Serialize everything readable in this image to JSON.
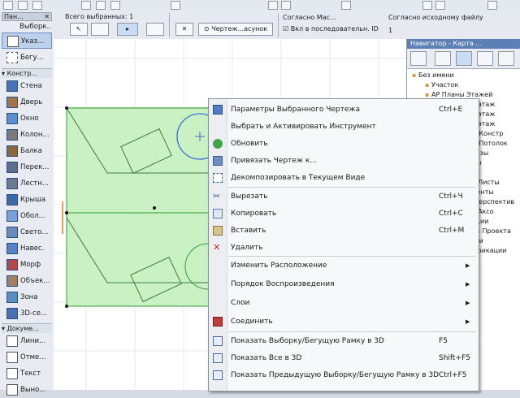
{
  "toolbox": {
    "header": "Пан...",
    "select_label": "Выборк...",
    "arrow_tool": "Указ...",
    "marquee_tool": "Бегу...",
    "section_design": "Констр...",
    "design_tools": [
      "Стена",
      "Дверь",
      "Окно",
      "Колон...",
      "Балка",
      "Перек...",
      "Лестн...",
      "Крыша",
      "Обол...",
      "Свето...",
      "Навес.",
      "Морф",
      "Объек...",
      "Зона",
      "3D-се..."
    ],
    "section_document": "Докуме...",
    "document_tools": [
      "Лини...",
      "Отме...",
      "Текст",
      "Выно..."
    ]
  },
  "infobox": {
    "selection_label": "Всего выбранных: 1",
    "drawing_button": "Чертеж...асунок",
    "scale_label": "Согласно Мас...",
    "sequence_check": "Вкл в последовательн. ID",
    "original_size_label": "Согласно исходному файлу",
    "original_value": "1"
  },
  "navigator": {
    "title": "Навигатор - Карта ...",
    "tree": [
      "Без имени",
      "Участок",
      "АР Планы Этажей",
      "...й этаж",
      "...й этаж",
      "...й этаж",
      "...ы Констр",
      "...ы Потолок",
      "...резы",
      "...ды",
      "...ри",
      "...е Листы",
      "...менты",
      "... Перспектив",
      "...е Аксо",
      "...ации",
      "...ии Проекта",
      "...сти",
      "...ификации"
    ]
  },
  "context_menu": {
    "items": [
      {
        "label": "Параметры Выбранного Чертежа",
        "shortcut": "Ctrl+E",
        "icon": "settings-icon"
      },
      {
        "label": "Выбрать и Активировать Инструмент",
        "shortcut": "",
        "icon": ""
      },
      {
        "label": "Обновить",
        "shortcut": "",
        "icon": "refresh-icon"
      },
      {
        "label": "Привязать Чертеж к...",
        "shortcut": "",
        "icon": "link-icon"
      },
      {
        "label": "Декомпозировать в Текущем Виде",
        "shortcut": "",
        "icon": "decompose-icon"
      },
      {
        "label": "Вырезать",
        "shortcut": "Ctrl+Ч",
        "icon": "scissors-icon"
      },
      {
        "label": "Копировать",
        "shortcut": "Ctrl+C",
        "icon": "copy-icon"
      },
      {
        "label": "Вставить",
        "shortcut": "Ctrl+M",
        "icon": "paste-icon"
      },
      {
        "label": "Удалить",
        "shortcut": "",
        "icon": "delete-icon"
      },
      {
        "label": "Изменить Расположение",
        "shortcut": "",
        "icon": "",
        "submenu": true
      },
      {
        "label": "Порядок Воспроизведения",
        "shortcut": "",
        "icon": "",
        "submenu": true
      },
      {
        "label": "Слои",
        "shortcut": "",
        "icon": "",
        "submenu": true
      },
      {
        "label": "Соединить",
        "shortcut": "",
        "icon": "connect-icon",
        "submenu": true
      },
      {
        "label": "Показать Выборку/Бегущую Рамку в 3D",
        "shortcut": "F5",
        "icon": "show3d-icon"
      },
      {
        "label": "Показать Все в 3D",
        "shortcut": "Shift+F5",
        "icon": "show3d-icon"
      },
      {
        "label": "Показать Предыдущую Выборку/Бегущую Рамку в 3D",
        "shortcut": "Ctrl+F5",
        "icon": "show3d-icon"
      }
    ]
  },
  "colors": {
    "selection_fill": "#c9f1c3",
    "selection_stroke": "#2f9a2f",
    "circle": "#3a6fd8",
    "highlight": "#e03a3a"
  }
}
